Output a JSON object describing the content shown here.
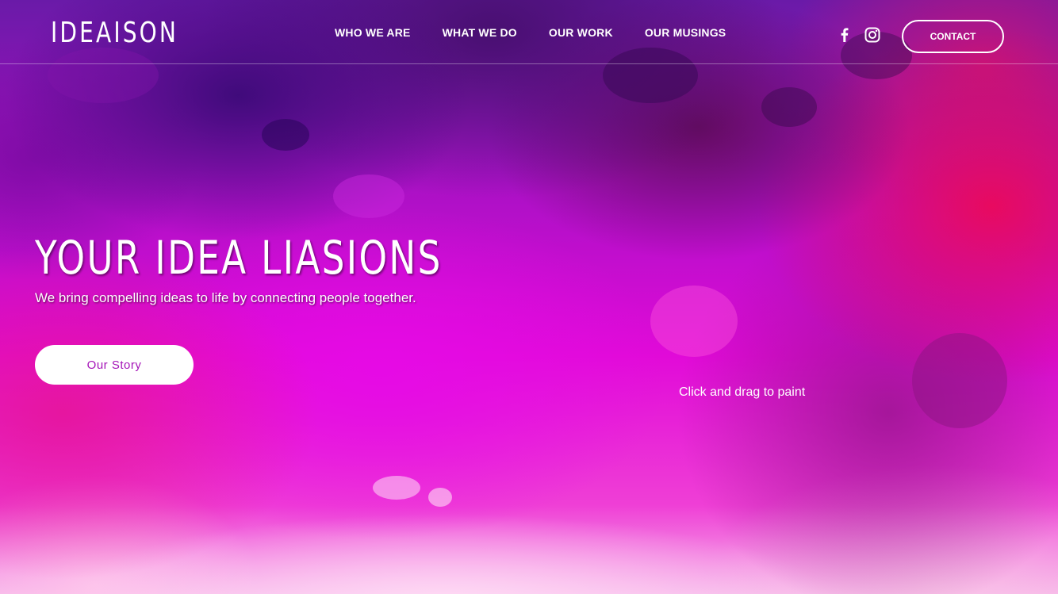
{
  "header": {
    "logo": "IDEAISON",
    "nav": [
      {
        "label": "WHO WE ARE"
      },
      {
        "label": "WHAT WE DO"
      },
      {
        "label": "OUR WORK"
      },
      {
        "label": "OUR MUSINGS"
      }
    ],
    "social": {
      "facebook": "facebook-icon",
      "instagram": "instagram-icon"
    },
    "contact_label": "CONTACT"
  },
  "hero": {
    "title": "YOUR IDEA LIASIONS",
    "subtitle": "We bring compelling ideas to life by connecting people together.",
    "cta_label": "Our Story",
    "paint_hint": "Click and drag to paint"
  },
  "colors": {
    "accent": "#a514b8",
    "text": "#ffffff"
  }
}
